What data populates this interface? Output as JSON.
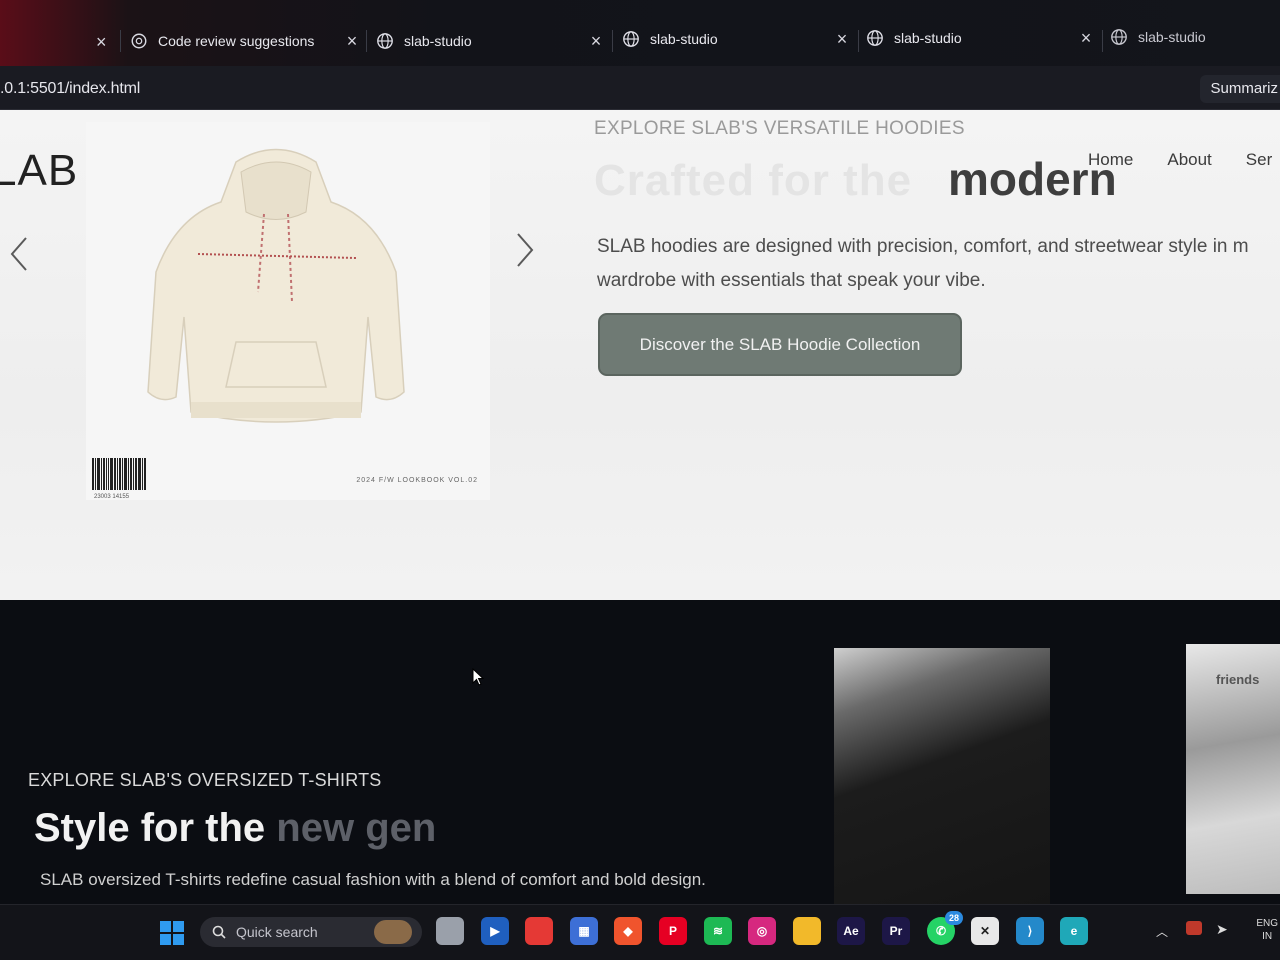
{
  "browser": {
    "tabs": [
      {
        "title": "Code review suggestions",
        "icon": "openai-icon"
      },
      {
        "title": "slab-studio",
        "icon": "globe-icon"
      },
      {
        "title": "slab-studio",
        "icon": "globe-icon"
      },
      {
        "title": "slab-studio",
        "icon": "globe-icon"
      },
      {
        "title": "slab-studio",
        "icon": "globe-icon"
      }
    ],
    "close_glyph": "×",
    "url": ".0.1:5501/index.html",
    "summarize_label": "Summariz"
  },
  "site": {
    "logo": "LAB",
    "nav": [
      "Home",
      "About",
      "Ser"
    ],
    "hero": {
      "eyebrow": "EXPLORE SLAB'S VERSATILE HOODIES",
      "headline_ghost": "Crafted for the",
      "headline_strong": "modern",
      "description": "SLAB hoodies are designed with precision, comfort, and streetwear style in m wardrobe with essentials that speak your vibe.",
      "cta": "Discover the SLAB Hoodie Collection",
      "product_caption": "2024 F/W LOOKBOOK VOL.02",
      "barcode_number": "23003 14155"
    },
    "tshirts": {
      "eyebrow": "EXPLORE SLAB'S OVERSIZED T-SHIRTS",
      "title_strong": "Style for the",
      "title_ghost": "new gen",
      "description": "SLAB oversized T-shirts redefine casual fashion with a blend of comfort and bold design.",
      "photo_mark": "friends"
    }
  },
  "taskbar": {
    "search_placeholder": "Quick search",
    "apps": [
      {
        "name": "task-view-icon",
        "color": "#9aa0aa",
        "label": ""
      },
      {
        "name": "media-player-icon",
        "color": "#1f5fbf",
        "label": "▶"
      },
      {
        "name": "app-diamond-icon",
        "color": "#e53935",
        "label": ""
      },
      {
        "name": "store-icon",
        "color": "#3d6fd6",
        "label": "▦"
      },
      {
        "name": "brave-icon",
        "color": "#f0542d",
        "label": "◆"
      },
      {
        "name": "pinterest-icon",
        "color": "#e60023",
        "label": "P"
      },
      {
        "name": "spotify-icon",
        "color": "#1db954",
        "label": "≋"
      },
      {
        "name": "instagram-icon",
        "color": "#d6287f",
        "label": "◎"
      },
      {
        "name": "file-explorer-icon",
        "color": "#f2b92a",
        "label": ""
      },
      {
        "name": "after-effects-icon",
        "color": "#1d1747",
        "label": "Ae"
      },
      {
        "name": "premiere-icon",
        "color": "#1d1747",
        "label": "Pr"
      },
      {
        "name": "whatsapp-icon",
        "color": "#25d366",
        "label": "✆"
      },
      {
        "name": "capcut-icon",
        "color": "#e8e8e8",
        "label": "✕"
      },
      {
        "name": "vscode-icon",
        "color": "#2489ca",
        "label": "⟩"
      },
      {
        "name": "edge-icon",
        "color": "#1fa8b8",
        "label": "e"
      }
    ],
    "whatsapp_badge": "28",
    "language": [
      "ENG",
      "IN"
    ]
  },
  "colors": {
    "cta_bg": "#6f7a74",
    "hero_bg": "#f0f0f0",
    "dark_bg": "#0b0d12",
    "windows_blue": "#2f9bf0"
  }
}
